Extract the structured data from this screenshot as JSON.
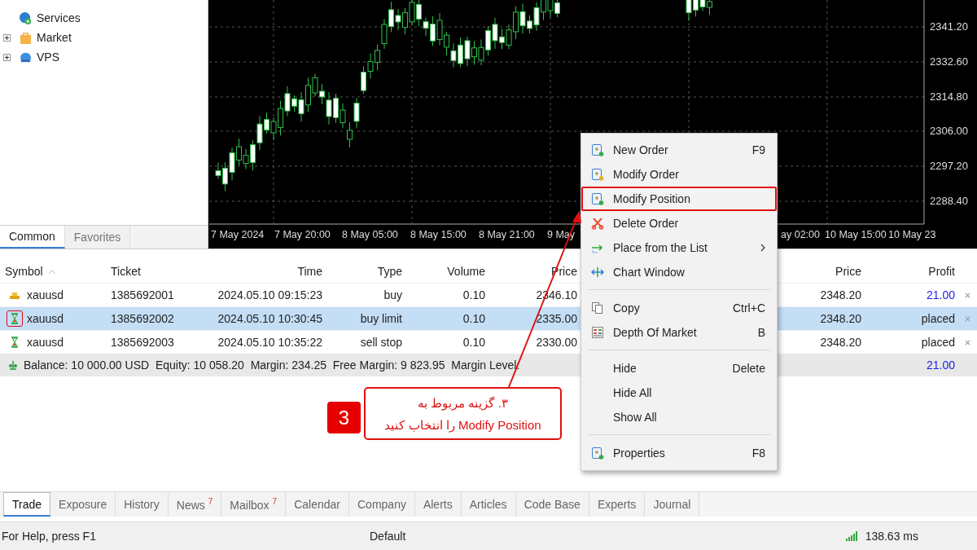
{
  "navigator": {
    "items": [
      {
        "label": "Services",
        "expandable": false
      },
      {
        "label": "Market",
        "expandable": true
      },
      {
        "label": "VPS",
        "expandable": true
      }
    ],
    "tabs": [
      {
        "label": "Common",
        "selected": true
      },
      {
        "label": "Favorites",
        "selected": false
      }
    ]
  },
  "chart": {
    "price_labels": [
      "2341.20",
      "2332.60",
      "2314.80",
      "2306.00",
      "2297.20",
      "2288.40"
    ],
    "time_labels": [
      "7 May 2024",
      "7 May 20:00",
      "8 May 05:00",
      "8 May 15:00",
      "8 May 21:00",
      "9 May",
      "ay 02:00",
      "10 May 15:00",
      "10 May 23"
    ]
  },
  "context_menu": {
    "items": [
      {
        "kind": "item",
        "label": "New Order",
        "shortcut": "F9",
        "submenu": false,
        "marked": false
      },
      {
        "kind": "item",
        "label": "Modify Order",
        "submenu": false,
        "marked": false
      },
      {
        "kind": "item",
        "label": "Modify Position",
        "submenu": false,
        "marked": true
      },
      {
        "kind": "item",
        "label": "Delete Order",
        "submenu": false,
        "marked": false
      },
      {
        "kind": "item",
        "label": "Place from the List",
        "submenu": true,
        "marked": false
      },
      {
        "kind": "item",
        "label": "Chart Window",
        "submenu": false,
        "marked": false
      },
      {
        "kind": "separator"
      },
      {
        "kind": "item",
        "label": "Copy",
        "shortcut": "Ctrl+C",
        "submenu": false,
        "marked": false
      },
      {
        "kind": "item",
        "label": "Depth Of Market",
        "shortcut": "B",
        "submenu": false,
        "marked": false
      },
      {
        "kind": "separator"
      },
      {
        "kind": "item",
        "label": "Hide",
        "shortcut": "Delete",
        "submenu": false,
        "marked": false
      },
      {
        "kind": "item",
        "label": "Hide All",
        "submenu": false,
        "marked": false
      },
      {
        "kind": "item",
        "label": "Show All",
        "submenu": false,
        "marked": false
      },
      {
        "kind": "separator"
      },
      {
        "kind": "item",
        "label": "Properties",
        "shortcut": "F8",
        "submenu": false,
        "marked": false
      }
    ]
  },
  "trade_table": {
    "columns": [
      {
        "label": "Symbol",
        "sorted": true
      },
      {
        "label": "Ticket",
        "sorted": false
      },
      {
        "label": "Time",
        "sorted": false
      },
      {
        "label": "Type",
        "sorted": false
      },
      {
        "label": "Volume",
        "sorted": false
      },
      {
        "label": "Price",
        "sorted": false
      },
      {
        "label": "Price",
        "sorted": false
      },
      {
        "label": "Profit",
        "sorted": false
      }
    ],
    "rows": [
      {
        "kind": "position",
        "cells": [
          "xauusd",
          "1385692001",
          "2024.05.10 09:15:23",
          "buy",
          "0.10",
          "2346.10",
          "2348.20",
          "21.00"
        ],
        "profit_positive": true,
        "selected": false,
        "marked": false
      },
      {
        "kind": "pending",
        "cells": [
          "xauusd",
          "1385692002",
          "2024.05.10 10:30:45",
          "buy limit",
          "0.10",
          "2335.00",
          "2348.20",
          "placed"
        ],
        "profit_positive": false,
        "selected": true,
        "marked": true
      },
      {
        "kind": "pending",
        "cells": [
          "xauusd",
          "1385692003",
          "2024.05.10 10:35:22",
          "sell stop",
          "0.10",
          "2330.00",
          "2348.20",
          "placed"
        ],
        "profit_positive": false,
        "selected": false,
        "marked": false
      }
    ],
    "summary": {
      "text": "Balance: 10 000.00 USD  Equity: 10 058.20  Margin: 234.25  Free Margin: 9 823.95  Margin Level:",
      "profit": "21.00"
    }
  },
  "annotation": {
    "step": "3",
    "text": "۳. گزینه مربوط به\nModify Position را انتخاب کنید"
  },
  "bottom_tabs": [
    {
      "label": "Trade",
      "selected": true
    },
    {
      "label": "Exposure",
      "selected": false
    },
    {
      "label": "History",
      "selected": false
    },
    {
      "label": "News",
      "badge": "7",
      "selected": false
    },
    {
      "label": "Mailbox",
      "badge": "7",
      "selected": false
    },
    {
      "label": "Calendar",
      "selected": false
    },
    {
      "label": "Company",
      "selected": false
    },
    {
      "label": "Alerts",
      "selected": false
    },
    {
      "label": "Articles",
      "selected": false
    },
    {
      "label": "Code Base",
      "selected": false
    },
    {
      "label": "Experts",
      "selected": false
    },
    {
      "label": "Journal",
      "selected": false
    }
  ],
  "status_bar": {
    "help": "For Help, press F1",
    "profile": "Default",
    "ping": "138.63 ms"
  }
}
